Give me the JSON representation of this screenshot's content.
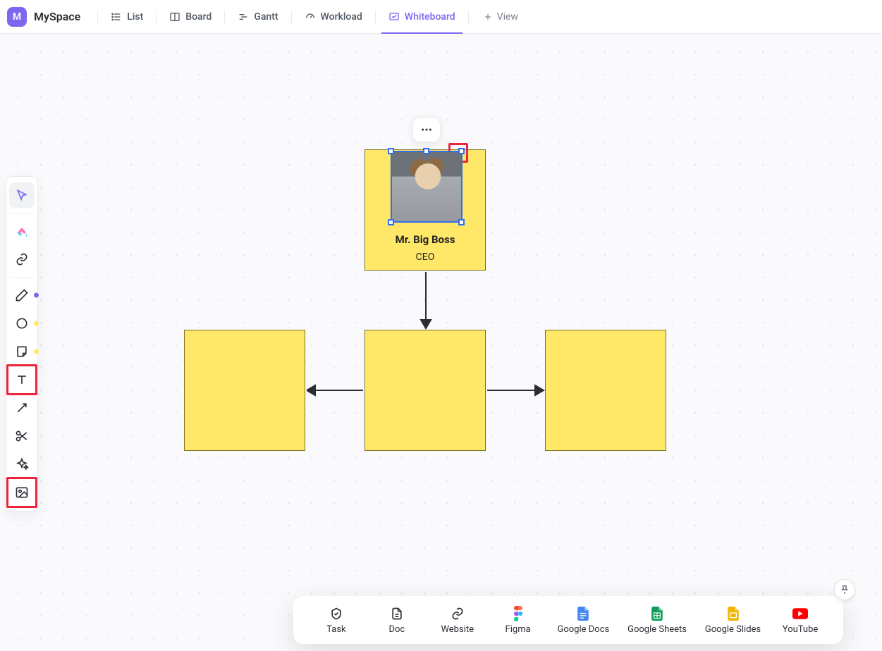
{
  "header": {
    "space_letter": "M",
    "space_title": "MySpace",
    "tabs": {
      "list": "List",
      "board": "Board",
      "gantt": "Gantt",
      "workload": "Workload",
      "whiteboard": "Whiteboard",
      "add_view": "View"
    }
  },
  "canvas": {
    "top_card": {
      "name": "Mr. Big Boss",
      "role": "CEO"
    }
  },
  "insert_bar": {
    "task": "Task",
    "doc": "Doc",
    "website": "Website",
    "figma": "Figma",
    "gdocs": "Google Docs",
    "gsheets": "Google Sheets",
    "gslides": "Google Slides",
    "youtube": "YouTube"
  },
  "tool_dots": {
    "pen": "#7B68EE",
    "shape": "#FFD93D",
    "sticky": "#FFD93D"
  }
}
